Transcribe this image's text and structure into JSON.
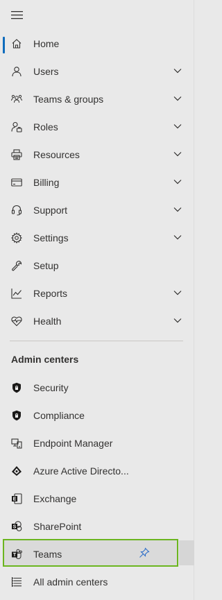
{
  "colors": {
    "accent": "#0f6cbd",
    "highlight_border": "#6bb51f",
    "text": "#323130",
    "background": "#e9e9e9"
  },
  "nav": {
    "menu_icon": "hamburger-icon",
    "items": [
      {
        "label": "Home",
        "icon": "home-icon",
        "expandable": false,
        "active": true
      },
      {
        "label": "Users",
        "icon": "user-icon",
        "expandable": true
      },
      {
        "label": "Teams & groups",
        "icon": "people-icon",
        "expandable": true
      },
      {
        "label": "Roles",
        "icon": "role-icon",
        "expandable": true
      },
      {
        "label": "Resources",
        "icon": "printer-icon",
        "expandable": true
      },
      {
        "label": "Billing",
        "icon": "card-icon",
        "expandable": true
      },
      {
        "label": "Support",
        "icon": "headset-icon",
        "expandable": true
      },
      {
        "label": "Settings",
        "icon": "gear-icon",
        "expandable": true
      },
      {
        "label": "Setup",
        "icon": "wrench-icon",
        "expandable": false
      },
      {
        "label": "Reports",
        "icon": "chart-icon",
        "expandable": true
      },
      {
        "label": "Health",
        "icon": "heart-pulse-icon",
        "expandable": true
      }
    ]
  },
  "admin_centers": {
    "title": "Admin centers",
    "items": [
      {
        "label": "Security",
        "icon": "security-shield-icon"
      },
      {
        "label": "Compliance",
        "icon": "compliance-shield-icon"
      },
      {
        "label": "Endpoint Manager",
        "icon": "endpoint-manager-icon"
      },
      {
        "label": "Azure Active Directo...",
        "icon": "azure-ad-icon"
      },
      {
        "label": "Exchange",
        "icon": "exchange-icon"
      },
      {
        "label": "SharePoint",
        "icon": "sharepoint-icon"
      },
      {
        "label": "Teams",
        "icon": "teams-icon",
        "pinned": true
      },
      {
        "label": "All admin centers",
        "icon": "list-icon"
      }
    ]
  }
}
